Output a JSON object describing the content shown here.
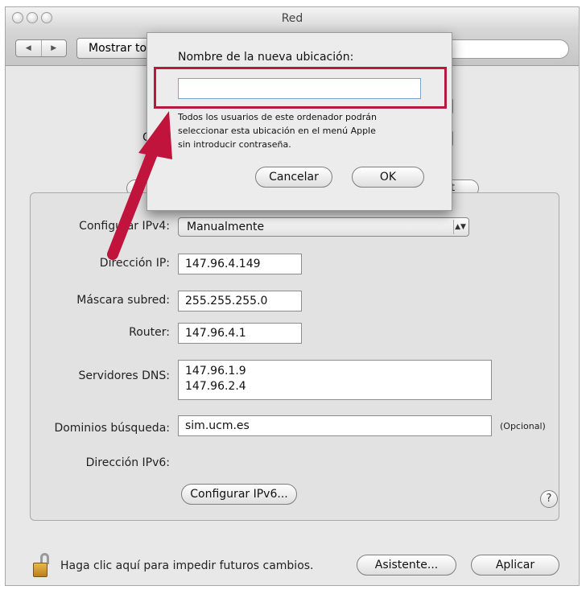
{
  "window": {
    "title": "Red"
  },
  "toolbar": {
    "back_label": "◀",
    "forward_label": "▶",
    "show_all_label": "Mostrar todo"
  },
  "hidden_fragments": {
    "location_initial": "C",
    "tab_fragment": "et"
  },
  "form": {
    "configure_ipv4_label": "Configurar IPv4:",
    "configure_ipv4_value": "Manualmente",
    "ip_label": "Dirección IP:",
    "ip_value": "147.96.4.149",
    "mask_label": "Máscara subred:",
    "mask_value": "255.255.255.0",
    "router_label": "Router:",
    "router_value": "147.96.4.1",
    "dns_label": "Servidores DNS:",
    "dns_values": [
      "147.96.1.9",
      "147.96.2.4"
    ],
    "search_domains_label": "Dominios búsqueda:",
    "search_domains_value": "sim.ucm.es",
    "optional_label": "(Opcional)",
    "ipv6_label": "Dirección IPv6:",
    "configure_ipv6_button": "Configurar IPv6...",
    "help_label": "?"
  },
  "footer": {
    "lock_text": "Haga clic aquí para impedir futuros cambios.",
    "assistant_button": "Asistente...",
    "apply_button": "Aplicar"
  },
  "sheet": {
    "title": "Nombre de la nueva ubicación:",
    "input_value": "",
    "note_lines": [
      "Todos los usuarios de este ordenador podrán",
      "seleccionar esta ubicación en el menú Apple",
      "sin introducir contraseña."
    ],
    "cancel_button": "Cancelar",
    "ok_button": "OK"
  },
  "colors": {
    "highlight": "#b8193f",
    "arrow": "#c0143c"
  },
  "icons": {
    "lock": "lock-icon",
    "arrow": "annotation-arrow"
  }
}
